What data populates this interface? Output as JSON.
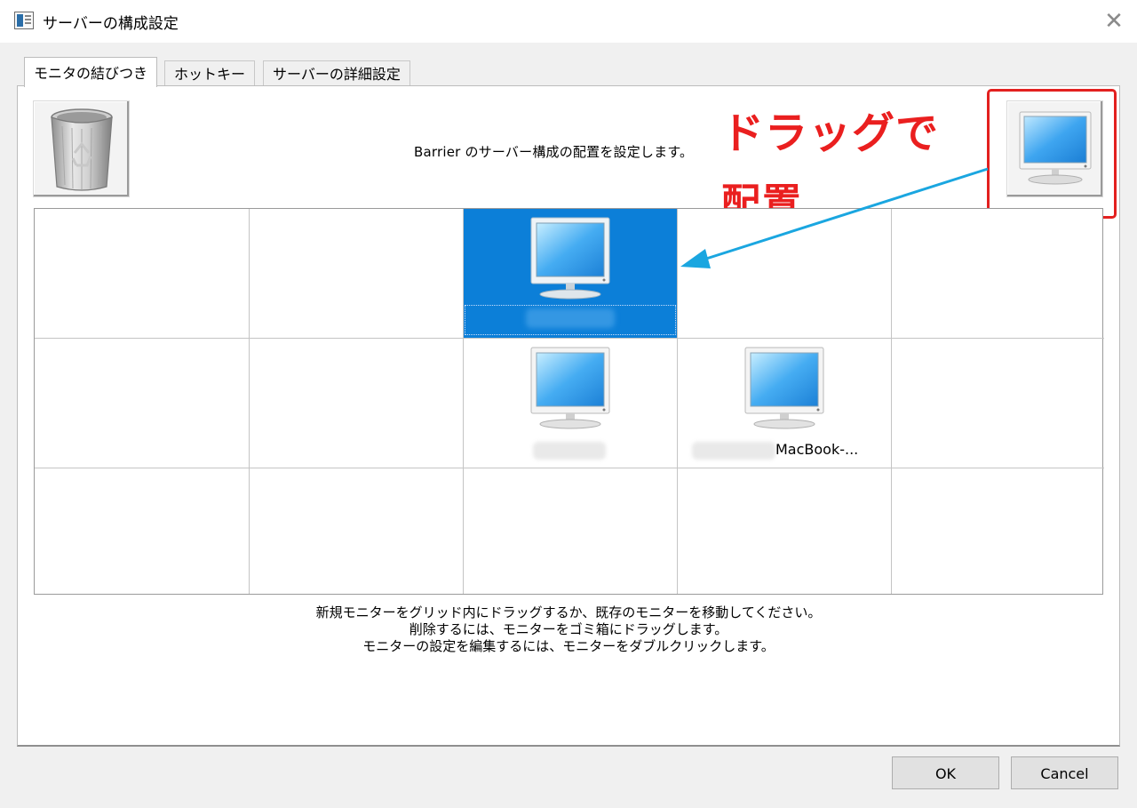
{
  "window": {
    "title": "サーバーの構成設定",
    "close_glyph": "✕"
  },
  "tabs": [
    {
      "label": "モニタの結びつき",
      "active": true
    },
    {
      "label": "ホットキー",
      "active": false
    },
    {
      "label": "サーバーの詳細設定",
      "active": false
    }
  ],
  "instruction": "Barrier のサーバー構成の配置を設定します。",
  "annotation": {
    "line1": "ドラッグで",
    "line2": "配置"
  },
  "grid": {
    "columns": 5,
    "rows": 3,
    "screens": [
      {
        "row": 0,
        "col": 2,
        "name": "",
        "selected": true,
        "name_blurred": true
      },
      {
        "row": 1,
        "col": 2,
        "name": "",
        "selected": false,
        "name_blurred": true
      },
      {
        "row": 1,
        "col": 3,
        "name": "MacBook-...",
        "selected": false,
        "name_blurred": true
      }
    ]
  },
  "help": {
    "lines": [
      "新規モニターをグリッド内にドラッグするか、既存のモニターを移動してください。",
      "削除するには、モニターをゴミ箱にドラッグします。",
      "モニターの設定を編集するには、モニターをダブルクリックします。"
    ]
  },
  "buttons": {
    "ok": "OK",
    "cancel": "Cancel"
  },
  "colors": {
    "selected_cell": "#0c7fd8",
    "annotation_red": "#ea1f1f",
    "annotation_arrow": "#1aa6e0"
  },
  "icons": {
    "trash": "recycle-bin-icon",
    "new_screen": "monitor-icon",
    "app": "window-app-icon",
    "close": "close-icon"
  }
}
